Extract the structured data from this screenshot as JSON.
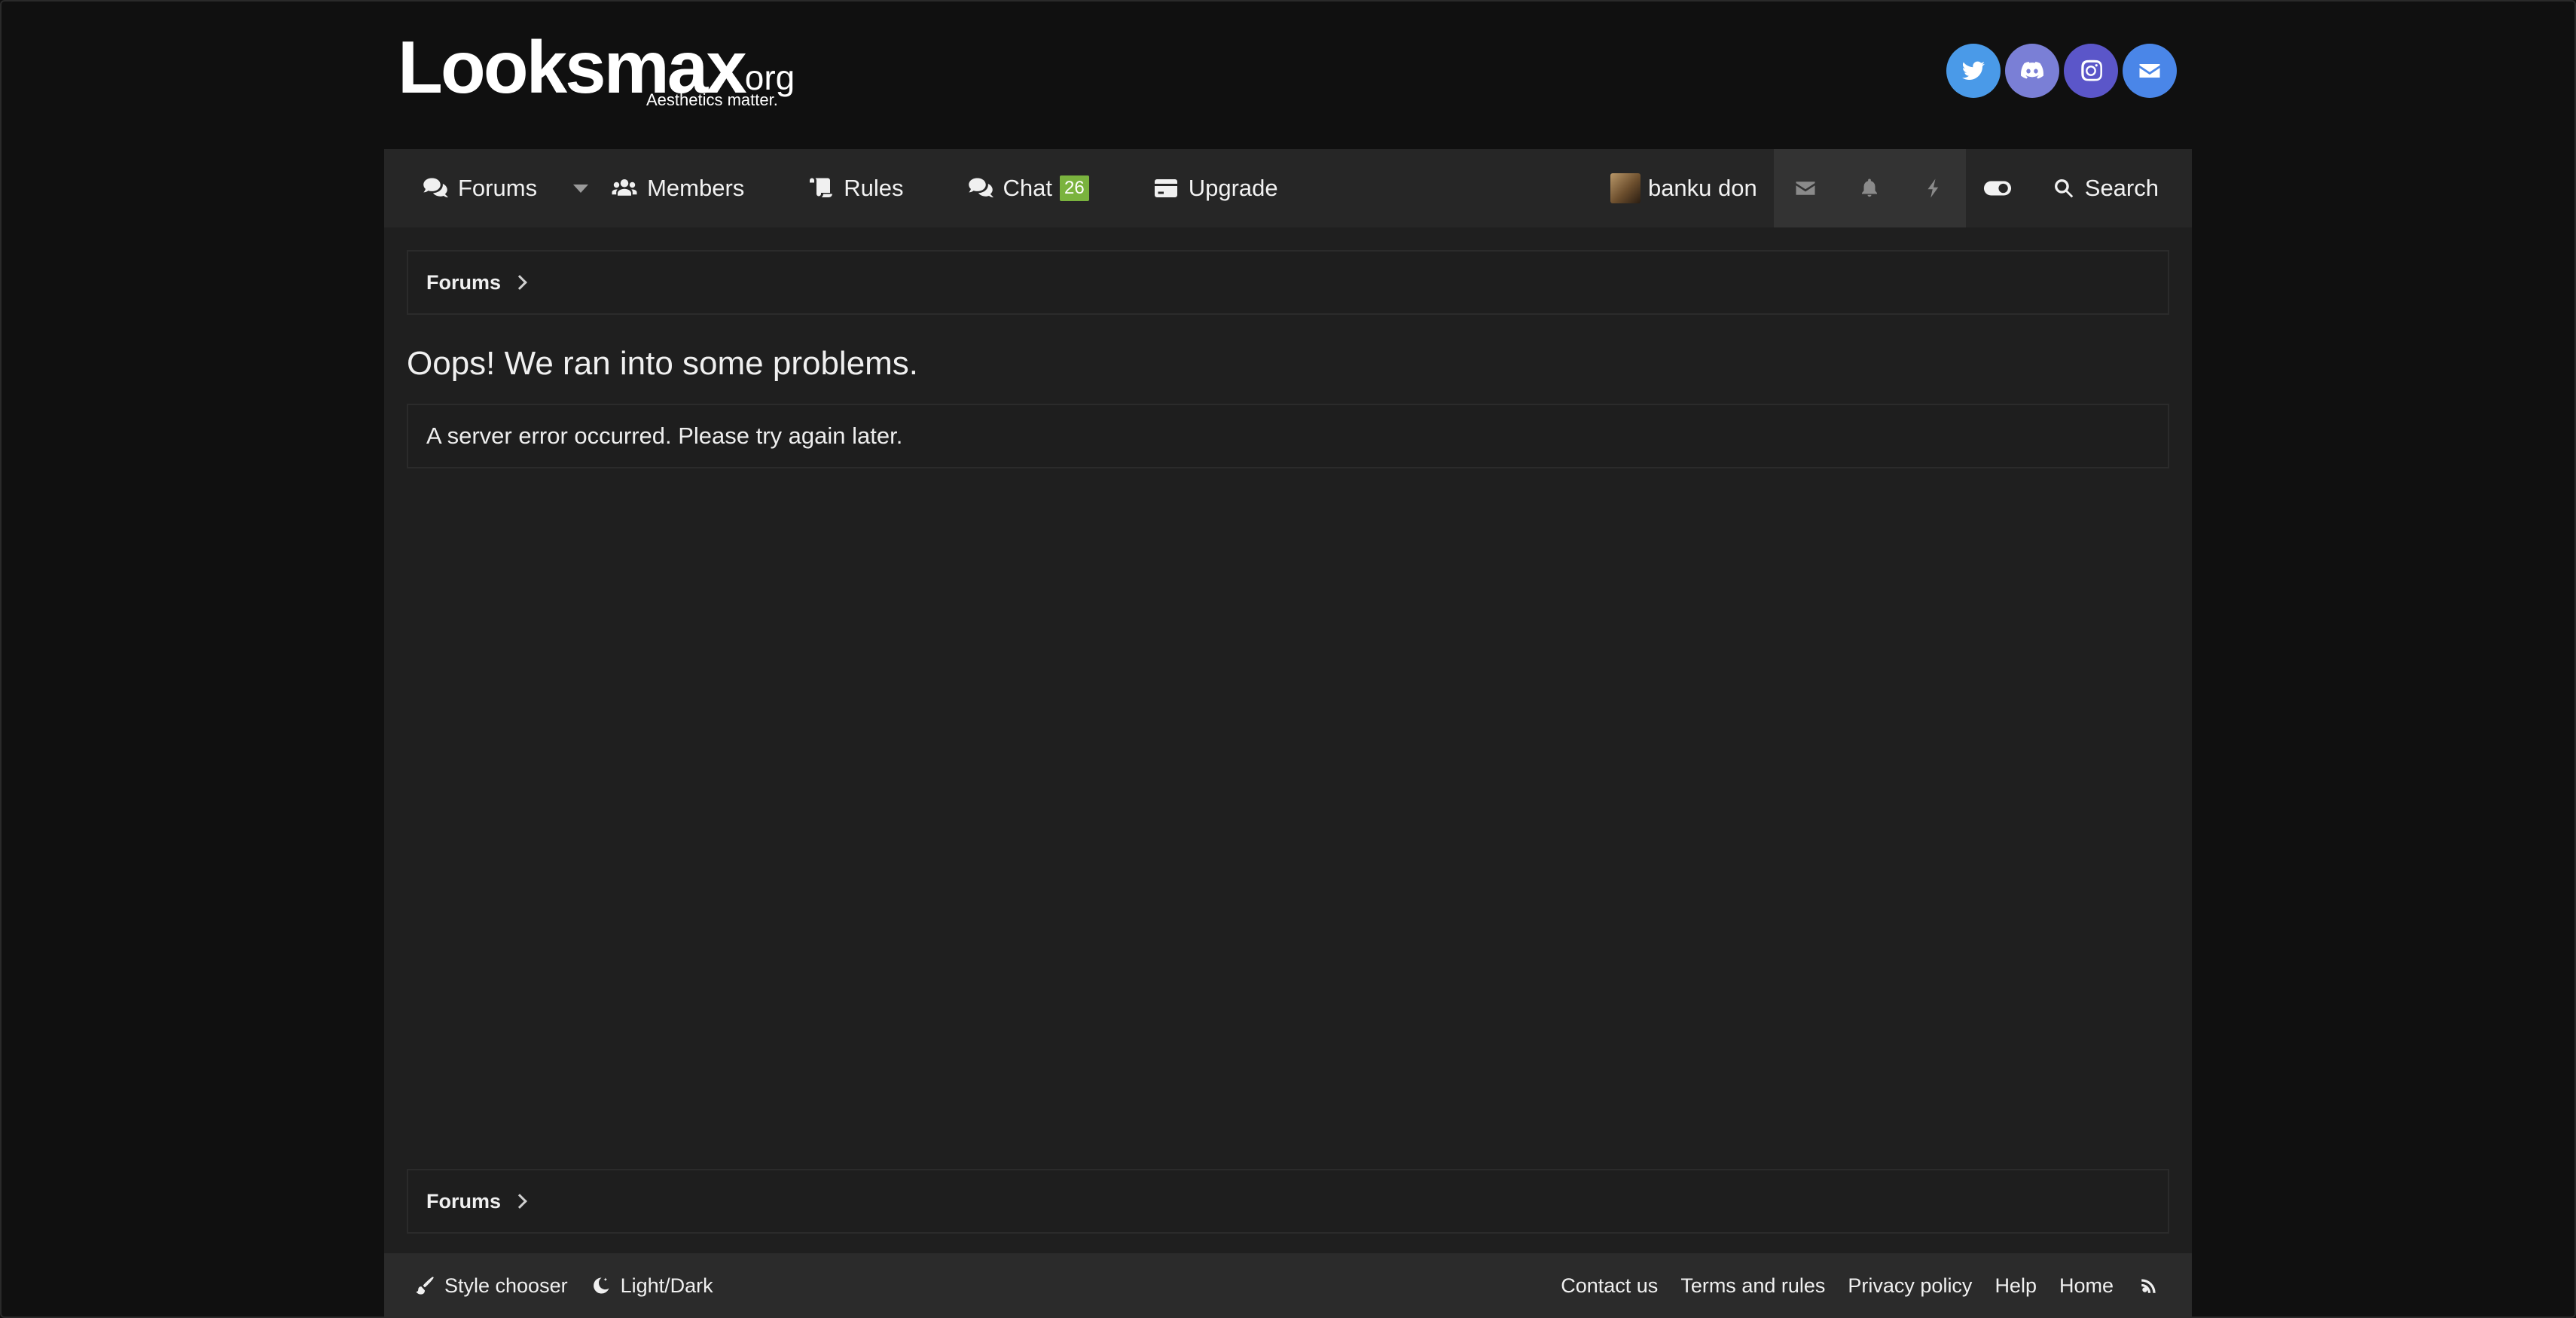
{
  "brand": {
    "logo_main": "Looksmax",
    "logo_org": ".org",
    "tagline": "Aesthetics matter."
  },
  "socials": [
    {
      "name": "twitter-icon",
      "color": "#4a9ae8"
    },
    {
      "name": "discord-icon",
      "color": "#7a7fd6"
    },
    {
      "name": "instagram-icon",
      "color": "#5b56c9"
    },
    {
      "name": "mail-icon",
      "color": "#4a86e8"
    }
  ],
  "nav": {
    "forums": "Forums",
    "members": "Members",
    "rules": "Rules",
    "chat": "Chat",
    "chat_badge": "26",
    "upgrade": "Upgrade",
    "username": "banku don",
    "search": "Search"
  },
  "breadcrumb": {
    "forums": "Forums"
  },
  "error": {
    "title": "Oops! We ran into some problems.",
    "message": "A server error occurred. Please try again later."
  },
  "footer": {
    "style_chooser": "Style chooser",
    "light_dark": "Light/Dark",
    "links": [
      "Contact us",
      "Terms and rules",
      "Privacy policy",
      "Help",
      "Home"
    ]
  },
  "colors": {
    "badge": "#7ab33e",
    "background": "#101010",
    "panel": "#1f1f1f",
    "nav": "#262626"
  }
}
